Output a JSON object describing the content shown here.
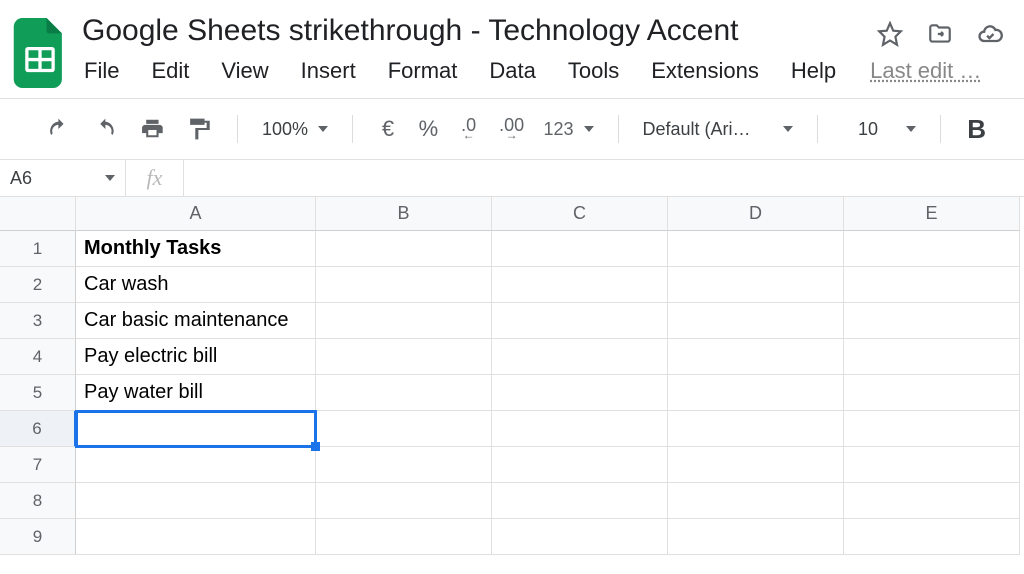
{
  "doc": {
    "title": "Google Sheets strikethrough - Technology Accent",
    "last_edit": "Last edit …"
  },
  "menu": {
    "file": "File",
    "edit": "Edit",
    "view": "View",
    "insert": "Insert",
    "format": "Format",
    "data": "Data",
    "tools": "Tools",
    "extensions": "Extensions",
    "help": "Help"
  },
  "toolbar": {
    "zoom": "100%",
    "currency_symbol": "€",
    "percent": "%",
    "dec_decrease": ".0",
    "dec_increase": ".00",
    "more_formats": "123",
    "font": "Default (Ari…",
    "font_size": "10",
    "bold_label": "B"
  },
  "name_box": "A6",
  "fx_label": "fx",
  "columns": [
    "A",
    "B",
    "C",
    "D",
    "E"
  ],
  "rows": [
    "1",
    "2",
    "3",
    "4",
    "5",
    "6",
    "7",
    "8",
    "9"
  ],
  "cells": {
    "A1": "Monthly Tasks",
    "A2": "Car wash",
    "A3": "Car basic maintenance",
    "A4": "Pay electric bill",
    "A5": "Pay water bill"
  },
  "selected_cell": "A6",
  "selected_row": "6"
}
